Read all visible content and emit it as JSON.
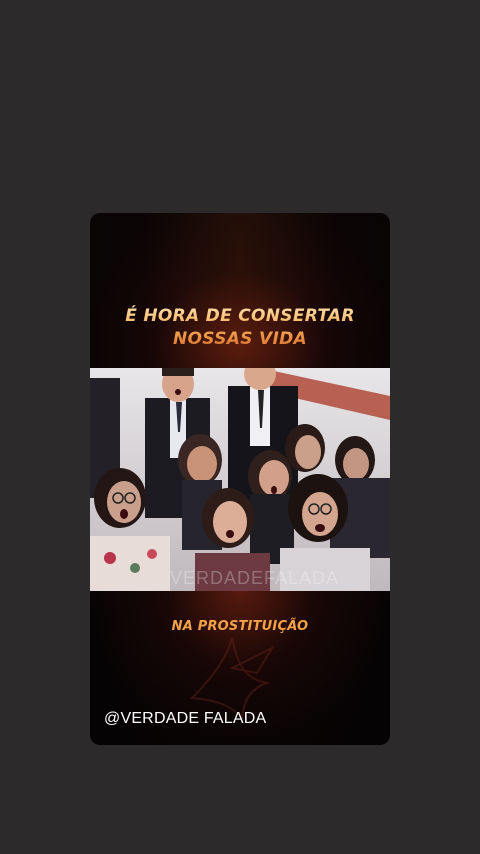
{
  "story": {
    "headline_line1": "É HORA DE CONSERTAR",
    "headline_line2": "NOSSAS VIDA",
    "photo_watermark": "VERDADEFALADA",
    "caption": "NA PROSTITUIÇÃO",
    "handle": "@VERDADE FALADA",
    "bird_icon": "dove-icon"
  },
  "colors": {
    "page_background": "#2c2a2b",
    "card_background": "#050304",
    "headline_gold": "#f7b25a",
    "caption_orange": "#f2a248",
    "handle_text": "#ffffff"
  }
}
